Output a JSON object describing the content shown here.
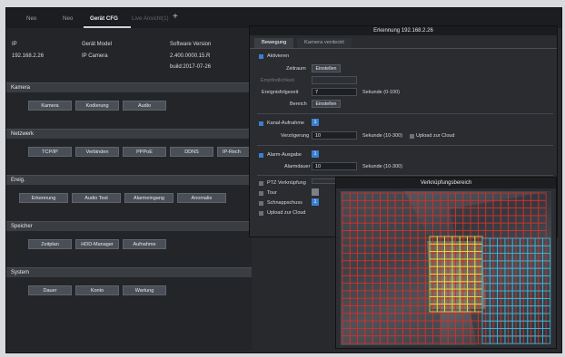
{
  "tabs": [
    {
      "label": "Neo"
    },
    {
      "label": "Neo"
    },
    {
      "label": "Gerät CFG"
    },
    {
      "label": "Live Ansicht(1)"
    }
  ],
  "tab_add_icon": "+",
  "info": {
    "headers": [
      "IP",
      "Gerät Model",
      "Software Version"
    ],
    "ip": "192.168.2.26",
    "model": "IP Camera",
    "version": "2.400.0000.15.R",
    "build": "build:2017-07-26"
  },
  "sections": [
    {
      "title": "Kamera",
      "buttons": [
        "Kamera",
        "Kodierung",
        "Audio"
      ]
    },
    {
      "title": "Netzwerk",
      "buttons": [
        "TCP/IP",
        "Verbinden",
        "PPPoE",
        "DDNS",
        "IP-Rech"
      ]
    },
    {
      "title": "Ereig.",
      "buttons": [
        "Erkennung",
        "Audio Test",
        "Alarmeingang",
        "Anomalie"
      ]
    },
    {
      "title": "Speicher",
      "buttons": [
        "Zeitplan",
        "HDD-Manager",
        "Aufnahme"
      ]
    },
    {
      "title": "System",
      "buttons": [
        "Dauer",
        "Konto",
        "Wartung"
      ]
    }
  ],
  "panel": {
    "title": "Erkennung 192.168.2.26",
    "tabs": [
      "Bewegung",
      "Kamera verdeckt"
    ],
    "activate": "Aktivieren",
    "zeitraum": "Zeitraum",
    "einstellen": "Einstellen",
    "empfindlichkeit": "Empfindlichkeit",
    "ereignis_label": "Ereignisfolgezeit",
    "ereignis_value": "7",
    "ereignis_unit": "Sekunde (0-100)",
    "bereich": "Bereich",
    "kanal": "Kanal-Aufnahme",
    "kanal_num": "1",
    "verzoegerung": "Verzögerung",
    "verzoegerung_value": "10",
    "verzoegerung_unit": "Sekunde (10-300)",
    "upload": "Upload zur Cloud",
    "alarm_ausgabe": "Alarm-Ausgabe",
    "alarm_num": "1",
    "alarmdauer": "Alarmdauer",
    "alarmdauer_value": "10",
    "alarmdauer_unit": "Sekunde (10-300)",
    "ptz": "PTZ Verknüpfung",
    "tour": "Tour",
    "schnappschuss": "Schnappschuss",
    "schnapp_num": "1",
    "upload2": "Upload zur Cloud"
  },
  "overlay": {
    "title": "Verknüpfungsbereich",
    "colors": {
      "red": "#d0312d",
      "yellow": "#e6de3c",
      "cyan": "#3ab6dc"
    }
  }
}
